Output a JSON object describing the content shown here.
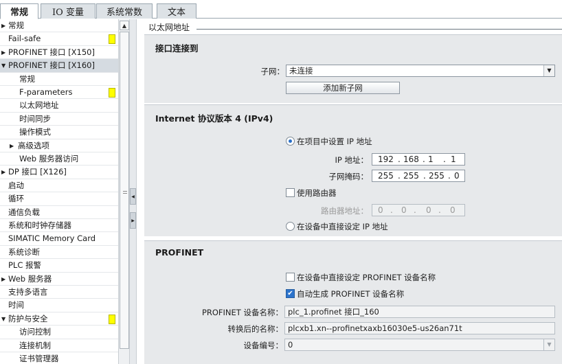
{
  "tabs": [
    {
      "label": "常规",
      "active": true
    },
    {
      "label": "IO 变量",
      "active": false
    },
    {
      "label": "系统常数",
      "active": false
    },
    {
      "label": "文本",
      "active": false
    }
  ],
  "tree": [
    {
      "label": "常规",
      "arrow": "▶",
      "indent": 0
    },
    {
      "label": "Fail-safe",
      "arrow": "",
      "indent": 0,
      "flag": true
    },
    {
      "label": "PROFINET 接口 [X150]",
      "arrow": "▶",
      "indent": 0
    },
    {
      "label": "PROFINET 接口 [X160]",
      "arrow": "▼",
      "indent": 0,
      "selected": true
    },
    {
      "label": "常规",
      "arrow": "",
      "indent": 2
    },
    {
      "label": "F-parameters",
      "arrow": "",
      "indent": 2,
      "flag": true
    },
    {
      "label": "以太网地址",
      "arrow": "",
      "indent": 2
    },
    {
      "label": "时间同步",
      "arrow": "",
      "indent": 2
    },
    {
      "label": "操作模式",
      "arrow": "",
      "indent": 2
    },
    {
      "label": "高级选项",
      "arrow": "▶",
      "indent": 1
    },
    {
      "label": "Web 服务器访问",
      "arrow": "",
      "indent": 2
    },
    {
      "label": "DP 接口 [X126]",
      "arrow": "▶",
      "indent": 0
    },
    {
      "label": "启动",
      "arrow": "",
      "indent": 0
    },
    {
      "label": "循环",
      "arrow": "",
      "indent": 0
    },
    {
      "label": "通信负载",
      "arrow": "",
      "indent": 0
    },
    {
      "label": "系统和时钟存储器",
      "arrow": "",
      "indent": 0
    },
    {
      "label": "SIMATIC Memory Card",
      "arrow": "",
      "indent": 0
    },
    {
      "label": "系统诊断",
      "arrow": "",
      "indent": 0
    },
    {
      "label": "PLC 报警",
      "arrow": "",
      "indent": 0
    },
    {
      "label": "Web 服务器",
      "arrow": "▶",
      "indent": 0
    },
    {
      "label": "支持多语言",
      "arrow": "",
      "indent": 0
    },
    {
      "label": "时间",
      "arrow": "",
      "indent": 0
    },
    {
      "label": "防护与安全",
      "arrow": "▼",
      "indent": 0,
      "flag": true
    },
    {
      "label": "访问控制",
      "arrow": "",
      "indent": 2
    },
    {
      "label": "连接机制",
      "arrow": "",
      "indent": 2
    },
    {
      "label": "证书管理器",
      "arrow": "",
      "indent": 2
    }
  ],
  "icons": {
    "scroll_up": "▲",
    "collapse_left": "◀",
    "expand_right": "▶",
    "dropdown": "▼",
    "check": "✔"
  },
  "crumb": "以太网地址",
  "interface": {
    "title": "接口连接到",
    "subnet_label": "子网：",
    "subnet_value": "未连接",
    "add_subnet_button": "添加新子网"
  },
  "ipv4": {
    "title": "Internet 协议版本 4 (IPv4)",
    "set_in_project_label": "在项目中设置 IP 地址",
    "set_in_project_selected": true,
    "ip_label": "IP 地址：",
    "ip": [
      "192",
      "168",
      "1",
      "1"
    ],
    "mask_label": "子网掩码：",
    "mask": [
      "255",
      "255",
      "255",
      "0"
    ],
    "use_router_label": "使用路由器",
    "use_router_checked": false,
    "router_label": "路由器地址：",
    "router": [
      "0",
      "0",
      "0",
      "0"
    ],
    "set_on_device_label": "在设备中直接设定 IP 地址",
    "set_on_device_selected": false
  },
  "profinet": {
    "title": "PROFINET",
    "set_name_on_device_label": "在设备中直接设定 PROFINET 设备名称",
    "set_name_on_device_checked": false,
    "auto_name_label": "自动生成 PROFINET 设备名称",
    "auto_name_checked": true,
    "device_name_label": "PROFINET 设备名称：",
    "device_name_value": "plc_1.profinet 接口_160",
    "converted_name_label": "转换后的名称：",
    "converted_name_value": "plcxb1.xn--profinetxaxb16030e5-us26an71t",
    "device_number_label": "设备编号：",
    "device_number_value": "0"
  }
}
